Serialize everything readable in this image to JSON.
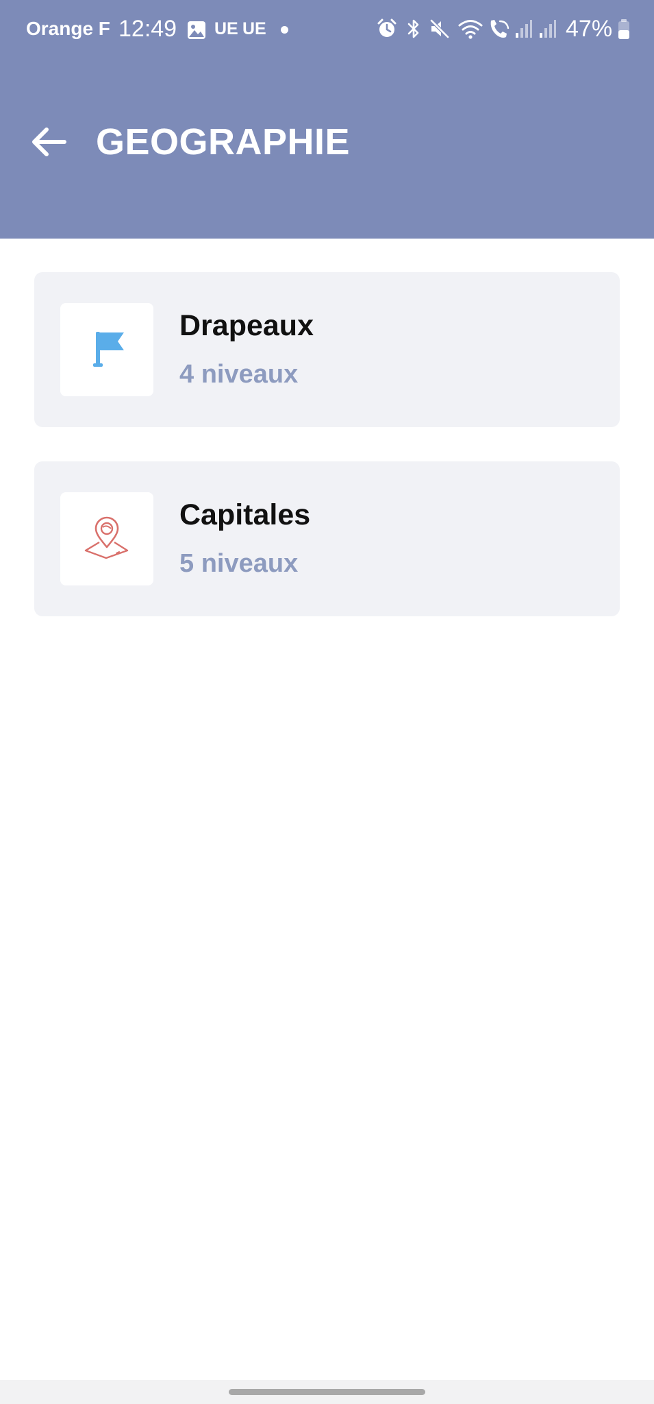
{
  "status_bar": {
    "carrier": "Orange F",
    "time": "12:49",
    "indicator_1": "UE",
    "indicator_2": "UE",
    "battery_percent": "47%",
    "icons": [
      "gallery-icon",
      "alarm-icon",
      "bluetooth-icon",
      "mute-icon",
      "wifi-icon",
      "wifi-calling-icon",
      "signal-icon",
      "signal-icon",
      "battery-icon"
    ]
  },
  "header": {
    "back_icon": "arrow-left-icon",
    "title": "GEOGRAPHIE",
    "background_color": "#7d8bb8"
  },
  "categories": [
    {
      "title": "Drapeaux",
      "subtitle": "4 niveaux",
      "icon": "flag-icon",
      "icon_color": "#5aade9"
    },
    {
      "title": "Capitales",
      "subtitle": "5 niveaux",
      "icon": "map-pin-icon",
      "icon_color": "#d9706b"
    }
  ],
  "colors": {
    "card_background": "#f1f2f6",
    "subtitle_color": "#8d9bbf"
  }
}
